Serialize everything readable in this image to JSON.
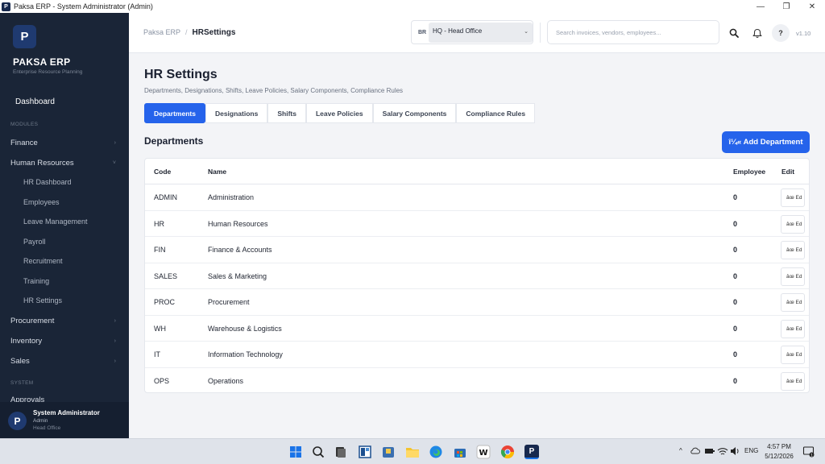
{
  "window": {
    "title": "Paksa ERP - System Administrator (Admin)",
    "controls": [
      "—",
      "❐",
      "✕"
    ]
  },
  "sidebar": {
    "logo_letter": "P",
    "brand": "PAKSA ERP",
    "brand_sub": "Enterprise Resource Planning",
    "dashboard": "Dashboard",
    "modules_label": "MODULES",
    "modules": [
      {
        "label": "Finance",
        "chevron": "›"
      },
      {
        "label": "Human Resources",
        "chevron": "˅"
      }
    ],
    "hr_sub": [
      "HR Dashboard",
      "Employees",
      "Leave Management",
      "Payroll",
      "Recruitment",
      "Training",
      "HR Settings"
    ],
    "modules_after": [
      {
        "label": "Procurement",
        "chevron": "›"
      },
      {
        "label": "Inventory",
        "chevron": "›"
      },
      {
        "label": "Sales",
        "chevron": "›"
      }
    ],
    "system_label": "SYSTEM",
    "system_items": [
      "Approvals"
    ],
    "user": {
      "avatar_letter": "P",
      "name": "System Administrator",
      "role": "Admin",
      "branch": "Head Office"
    }
  },
  "topbar": {
    "breadcrumb_root": "Paksa ERP",
    "breadcrumb_sep": "/",
    "breadcrumb_current": "HRSettings",
    "branch_code": "BR",
    "branch_value": "HQ - Head Office",
    "search_placeholder": "Search invoices, vendors, employees...",
    "help": "?",
    "version": "v1.10"
  },
  "main": {
    "title": "HR Settings",
    "subtitle": "Departments, Designations, Shifts, Leave Policies, Salary Components, Compliance Rules",
    "tabs": [
      "Departments",
      "Designations",
      "Shifts",
      "Leave Policies",
      "Salary Components",
      "Compliance Rules"
    ],
    "active_tab": "Departments",
    "section_title": "Departments",
    "add_button": "î¼« Add Department",
    "columns": {
      "code": "Code",
      "name": "Name",
      "employees": "Employee",
      "edit": "Edit"
    },
    "rows": [
      {
        "code": "ADMIN",
        "name": "Administration",
        "employees": "0",
        "edit": "âœ Ed"
      },
      {
        "code": "HR",
        "name": "Human Resources",
        "employees": "0",
        "edit": "âœ Ed"
      },
      {
        "code": "FIN",
        "name": "Finance & Accounts",
        "employees": "0",
        "edit": "âœ Ed"
      },
      {
        "code": "SALES",
        "name": "Sales & Marketing",
        "employees": "0",
        "edit": "âœ Ed"
      },
      {
        "code": "PROC",
        "name": "Procurement",
        "employees": "0",
        "edit": "âœ Ed"
      },
      {
        "code": "WH",
        "name": "Warehouse & Logistics",
        "employees": "0",
        "edit": "âœ Ed"
      },
      {
        "code": "IT",
        "name": "Information Technology",
        "employees": "0",
        "edit": "âœ Ed"
      },
      {
        "code": "OPS",
        "name": "Operations",
        "employees": "0",
        "edit": "âœ Ed"
      }
    ]
  },
  "taskbar": {
    "tray_lang": "ENG",
    "time": "4:57 PM",
    "date": "5/12/2026",
    "tray_caret": "^"
  }
}
